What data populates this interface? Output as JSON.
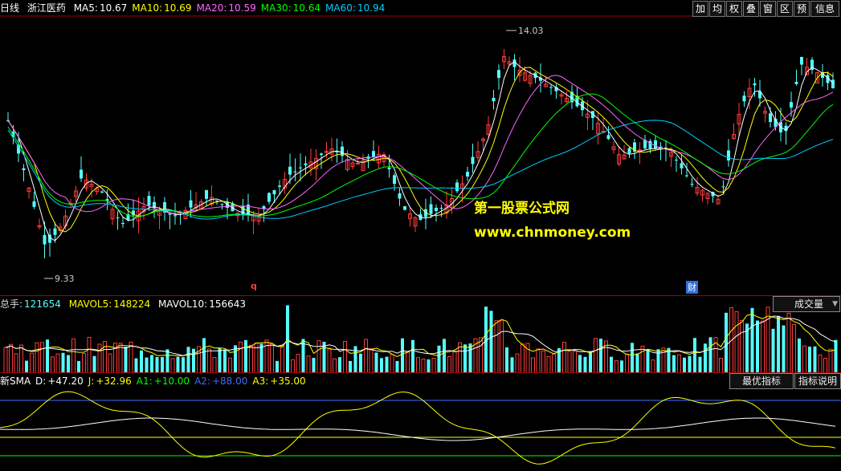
{
  "main": {
    "period": "日线",
    "stock_name": "浙江医药",
    "ma": [
      {
        "label": "MA5:",
        "value": "10.67",
        "color": "#ffffff"
      },
      {
        "label": "MA10:",
        "value": "10.69",
        "color": "#ffff00"
      },
      {
        "label": "MA20:",
        "value": "10.59",
        "color": "#ff66ff"
      },
      {
        "label": "MA30:",
        "value": "10.64",
        "color": "#00ff00"
      },
      {
        "label": "MA60:",
        "value": "10.94",
        "color": "#00ccff"
      }
    ],
    "toolbar": [
      "加",
      "均",
      "权",
      "叠",
      "窗",
      "区",
      "预",
      "信息"
    ],
    "high_label": "14.03",
    "low_label": "9.33",
    "marker_q": "q",
    "marker_cai": "财",
    "watermark_1": "第一股票公式网",
    "watermark_2": "www.chnmoney.com"
  },
  "volume": {
    "total_label": "总手:",
    "total_value": "121654",
    "mavol5_label": "MAVOL5:",
    "mavol5_value": "148224",
    "mavol10_label": "MAVOL10:",
    "mavol10_value": "156643",
    "dropdown": "成交量",
    "dropdown_icon": "caret-down-icon"
  },
  "indicator": {
    "name": "新SMA",
    "items": [
      {
        "label": "D:",
        "value": "+47.20",
        "color": "#ffffff"
      },
      {
        "label": "J:",
        "value": "+32.96",
        "color": "#ffff00"
      },
      {
        "label": "A1:",
        "value": "+10.00",
        "color": "#00ff00"
      },
      {
        "label": "A2:",
        "value": "+88.00",
        "color": "#3f6bff"
      },
      {
        "label": "A3:",
        "value": "+35.00",
        "color": "#ffff00"
      }
    ],
    "btn_best": "最优指标",
    "btn_help": "指标说明"
  },
  "colors": {
    "up": "#ff3c3c",
    "down": "#54ffff",
    "background": "#000000",
    "frame": "#a00000"
  }
}
